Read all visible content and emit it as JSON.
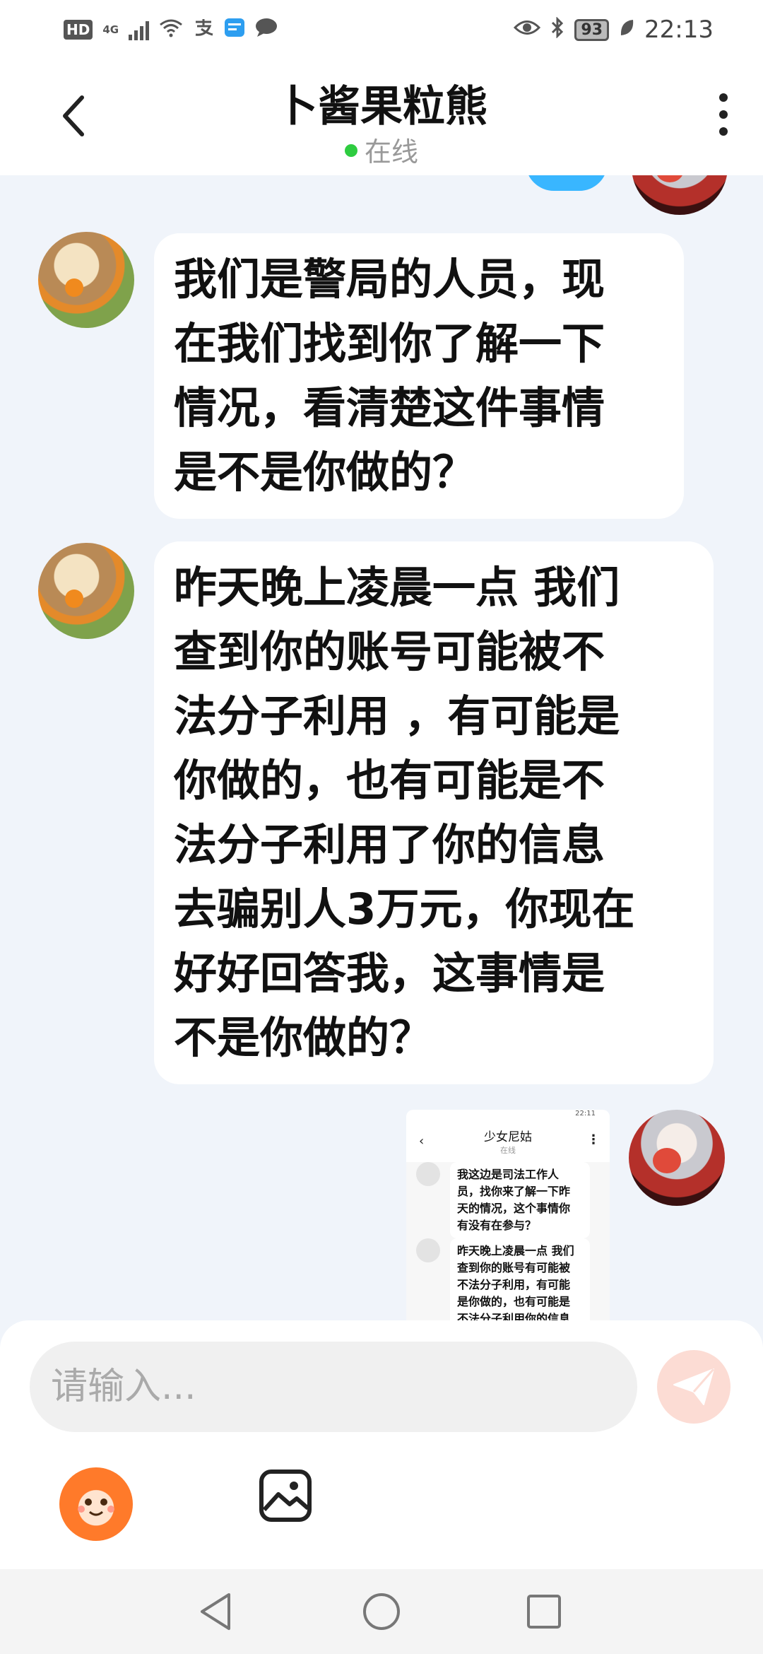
{
  "status_bar": {
    "hd": "HD",
    "network": "4G",
    "battery": "93",
    "time": "22:13"
  },
  "header": {
    "title": "卜酱果粒熊",
    "status": "在线"
  },
  "messages": [
    {
      "sender": "other",
      "text": "我们是警局的人员，现\n在我们找到你了解一下\n情况，看清楚这件事情\n是不是你做的？"
    },
    {
      "sender": "other",
      "text": "昨天晚上凌晨一点 我们\n查到你的账号可能被不\n法分子利用 ，有可能是\n你做的，也有可能是不\n法分子利用了你的信息\n去骗别人3万元，你现在\n好好回答我，这事情是\n不是你做的？"
    }
  ],
  "image_message": {
    "sender": "me",
    "status_time": "22:11",
    "title": "少女尼姑",
    "status": "在线",
    "lines": [
      "我这边是司法工作人\n员，找你来了解一下昨\n天的情况，这个事情你\n有没有在参与？",
      "昨天晚上凌晨一点 我们\n查到你的账号有可能被\n不法分子利用，有可能\n是你做的，也有可能是\n不法分子利用你的信息"
    ]
  },
  "input": {
    "placeholder": "请输入..."
  },
  "colors": {
    "background": "#f0f4fa",
    "online_dot": "#2ecc40",
    "send_button": "#fcdcd4",
    "peek_bubble": "#39b6ff"
  },
  "icons": [
    "back-icon",
    "more-icon",
    "send-icon",
    "emoji-icon",
    "image-icon",
    "nav-back-icon",
    "nav-home-icon",
    "nav-recents-icon"
  ]
}
